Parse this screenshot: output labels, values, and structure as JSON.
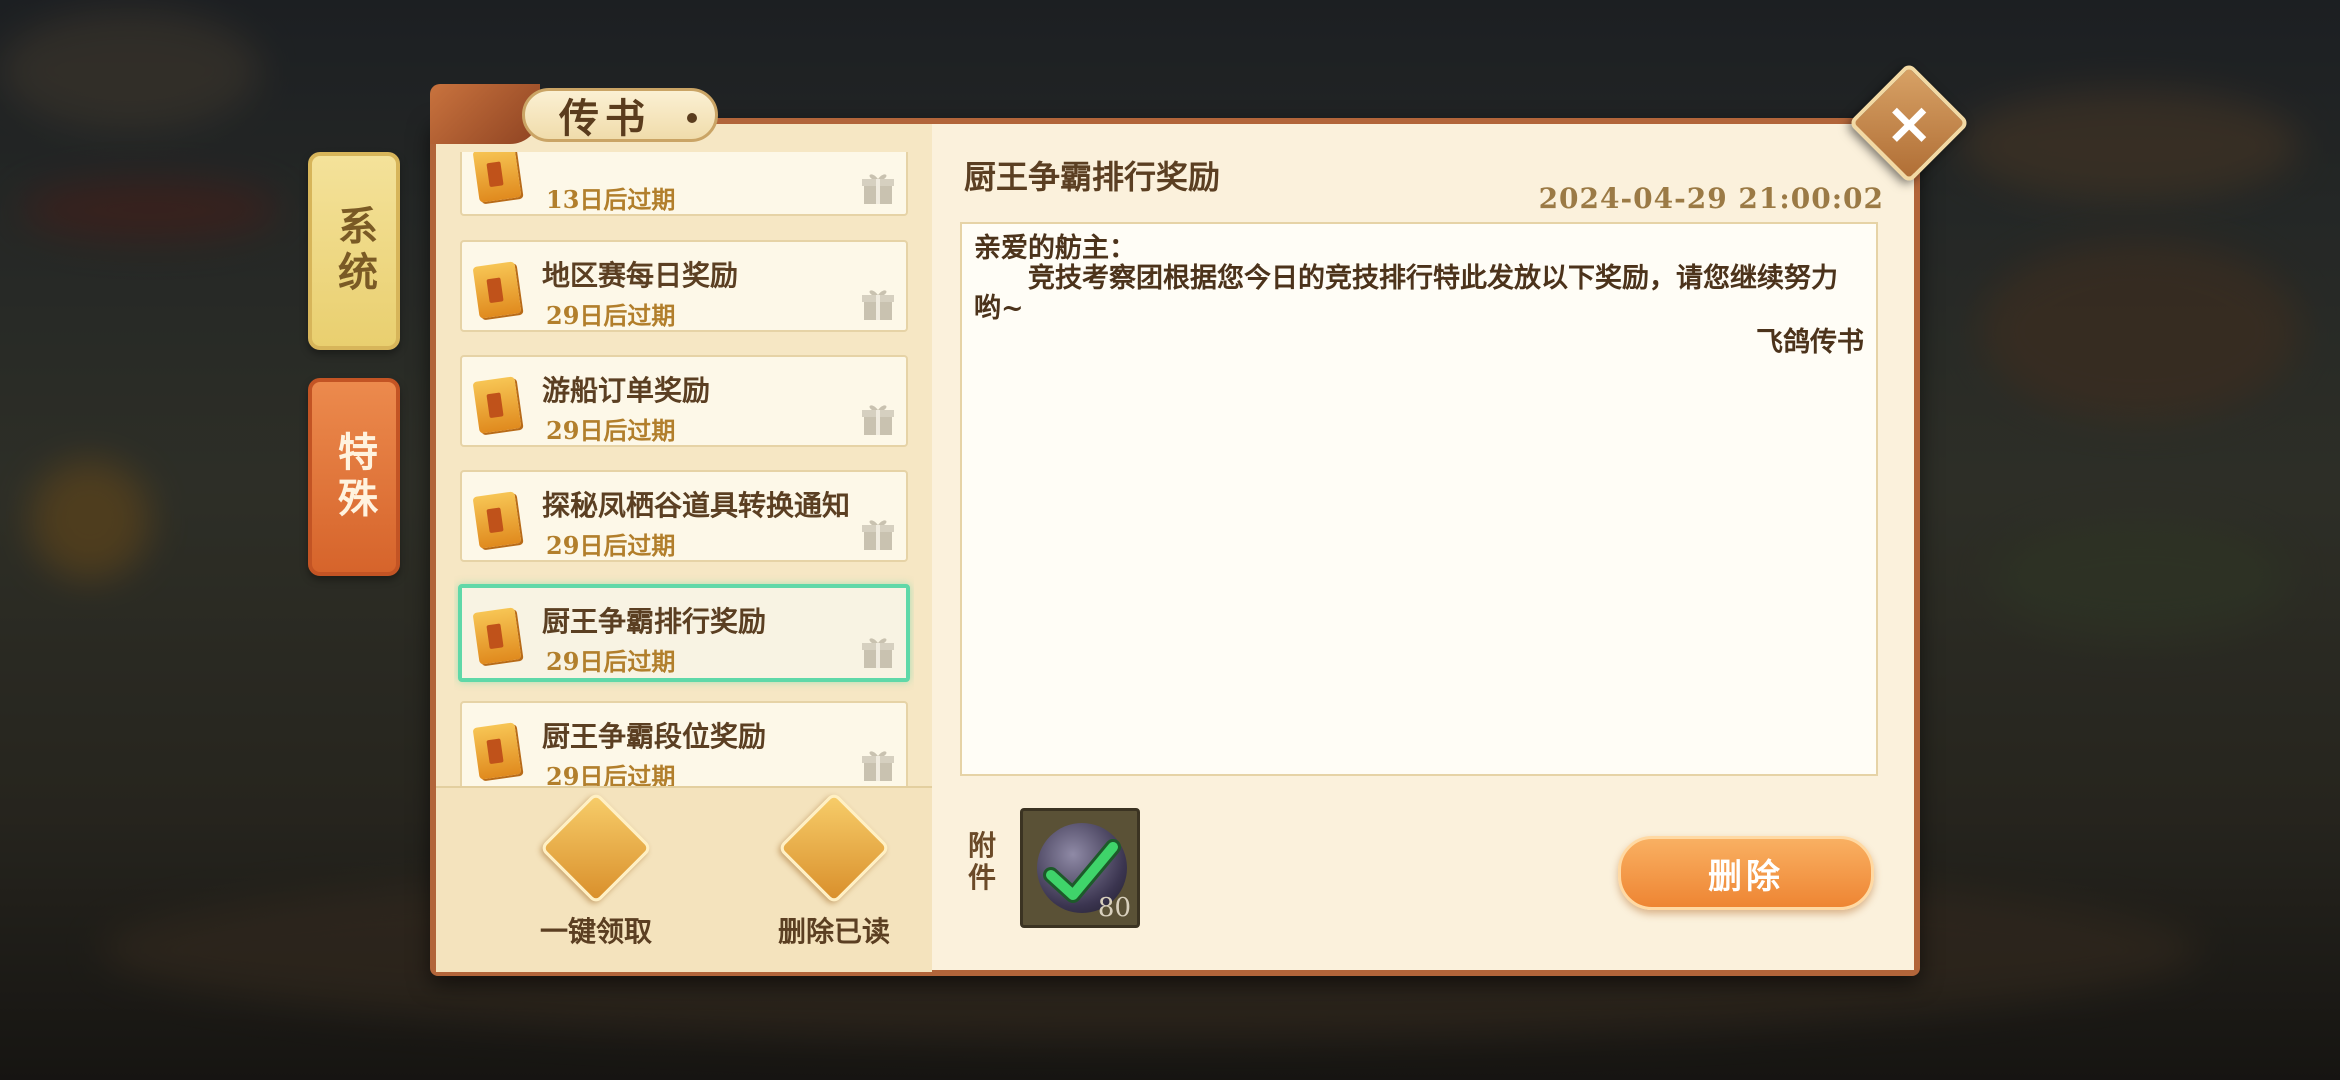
{
  "window": {
    "title": "传书"
  },
  "tabs": {
    "system": "系统",
    "special": "特殊"
  },
  "mails": [
    {
      "title": "",
      "expire": "13日后过期",
      "selected": false
    },
    {
      "title": "地区赛每日奖励",
      "expire": "29日后过期",
      "selected": false
    },
    {
      "title": "游船订单奖励",
      "expire": "29日后过期",
      "selected": false
    },
    {
      "title": "探秘凤栖谷道具转换通知",
      "expire": "29日后过期",
      "selected": false
    },
    {
      "title": "厨王争霸排行奖励",
      "expire": "29日后过期",
      "selected": true
    },
    {
      "title": "厨王争霸段位奖励",
      "expire": "29日后过期",
      "selected": false
    }
  ],
  "actions": {
    "collect_all": "一键领取",
    "delete_read": "删除已读"
  },
  "detail": {
    "title": "厨王争霸排行奖励",
    "time": "2024-04-29  21:00:02",
    "greeting": "亲爱的舫主：",
    "body": "竞技考察团根据您今日的竞技排行特此发放以下奖励，请您继续努力哟~",
    "signature": "飞鸽传书"
  },
  "attachment": {
    "label": "附件",
    "count": "80",
    "claimed": true,
    "icon": "purple-orb-icon"
  },
  "delete_button": "删除",
  "colors": {
    "accent": "#ee8533",
    "selected_border": "#5fd8a8",
    "panel_border": "#b2653a"
  }
}
